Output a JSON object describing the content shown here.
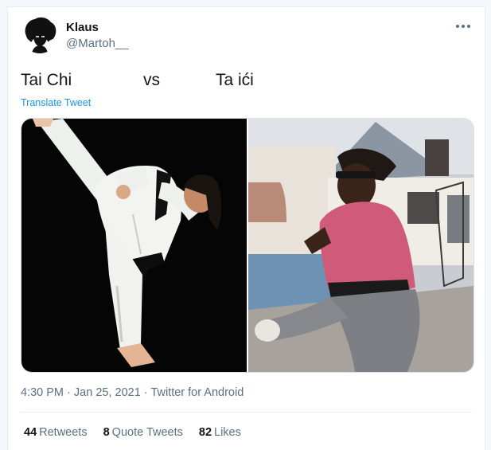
{
  "tweet": {
    "display_name": "Klaus",
    "handle": "@Martoh__",
    "text_left": "Tai Chi",
    "text_mid": "vs",
    "text_right": "Ta ići",
    "translate_label": "Translate Tweet",
    "time": "4:30 PM",
    "date": "Jan 25, 2021",
    "source": "Twitter for Android",
    "separator": "·"
  },
  "stats": {
    "retweets_count": "44",
    "retweets_label": "Retweets",
    "quotes_count": "8",
    "quotes_label": "Quote Tweets",
    "likes_count": "82",
    "likes_label": "Likes"
  },
  "icons": {
    "more": "more-horizontal-icon",
    "avatar": "afro-silhouette-avatar"
  },
  "colors": {
    "link": "#1b95e0",
    "secondary_text": "#5b7083",
    "primary_text": "#0f1419",
    "border": "#e6ecf0"
  }
}
